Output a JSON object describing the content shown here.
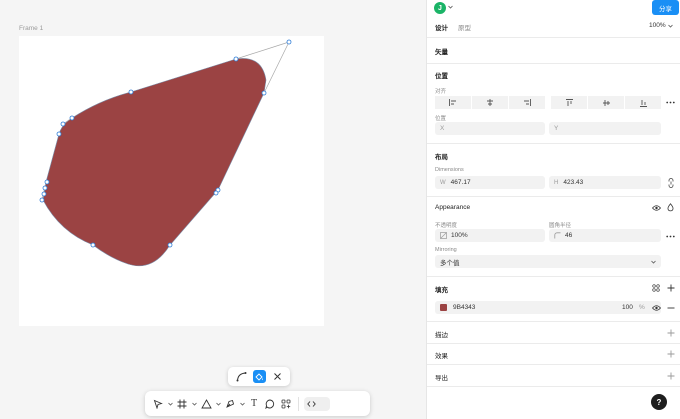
{
  "canvas": {
    "frame_label": "Frame 1",
    "shape_fill": "#9B4343"
  },
  "path_bar": {
    "bend_tool": "bend-icon",
    "paint_bucket_tool": "paint-bucket-icon",
    "close_tool": "close-icon"
  },
  "toolbar": {
    "tools": [
      "move-icon",
      "frame-icon",
      "shape-icon",
      "pen-icon",
      "text-icon",
      "comment-icon",
      "actions-icon",
      "code-icon"
    ],
    "text_glyph": "T"
  },
  "header": {
    "avatar_letter": "J",
    "share_label": "分享",
    "tabs": [
      "设计",
      "原型"
    ],
    "zoom": "100%"
  },
  "panel": {
    "vector_title": "矢量",
    "position": {
      "title": "位置",
      "align_label": "对齐",
      "position_label": "位置",
      "x_placeholder": "X",
      "y_placeholder": "Y"
    },
    "layout": {
      "title": "布局",
      "dimensions_label": "Dimensions",
      "w_prefix": "W",
      "w_value": "467.17",
      "h_prefix": "H",
      "h_value": "423.43"
    },
    "appearance": {
      "title": "Appearance",
      "opacity_label": "不透明度",
      "opacity_value": "100%",
      "radius_label": "圆角半径",
      "radius_value": "46",
      "mirroring_label": "Mirroring",
      "mirroring_value": "多个值"
    },
    "fill": {
      "title": "填充",
      "hex": "9B4343",
      "opacity": "100",
      "unit": "%",
      "swatch_color": "#9B4343"
    },
    "stroke_title": "描边",
    "effects_title": "效果",
    "export_title": "导出"
  },
  "help_label": "?"
}
